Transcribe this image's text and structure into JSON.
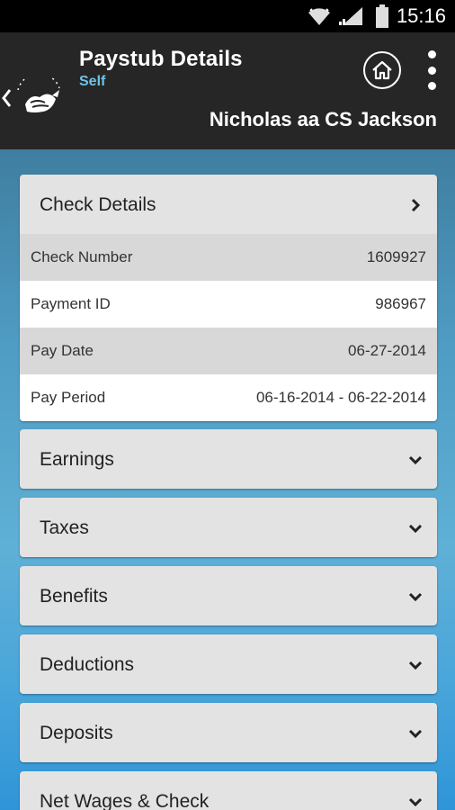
{
  "status_bar": {
    "time": "15:16"
  },
  "header": {
    "title": "Paystub Details",
    "subtitle": "Self",
    "user_name": "Nicholas aa CS Jackson"
  },
  "check_details": {
    "title": "Check Details",
    "rows": [
      {
        "label": "Check Number",
        "value": "1609927"
      },
      {
        "label": "Payment ID",
        "value": "986967"
      },
      {
        "label": "Pay Date",
        "value": "06-27-2014"
      },
      {
        "label": "Pay Period",
        "value": "06-16-2014 - 06-22-2014"
      }
    ]
  },
  "sections": [
    {
      "label": "Earnings"
    },
    {
      "label": "Taxes"
    },
    {
      "label": "Benefits"
    },
    {
      "label": "Deductions"
    },
    {
      "label": "Deposits"
    },
    {
      "label": "Net Wages & Check"
    }
  ],
  "colors": {
    "header_bg": "#262626",
    "subtitle": "#6ec3ea",
    "card_bg": "#e3e3e3",
    "row_shade": "#d8d8d8"
  },
  "icons": {
    "back": "back-chevron-icon",
    "logo": "logo-icon",
    "home": "home-icon",
    "overflow": "overflow-menu-icon",
    "wifi": "wifi-icon",
    "signal": "signal-icon",
    "battery": "battery-icon",
    "chevron_right": "chevron-right-icon",
    "chevron_down": "chevron-down-icon"
  }
}
